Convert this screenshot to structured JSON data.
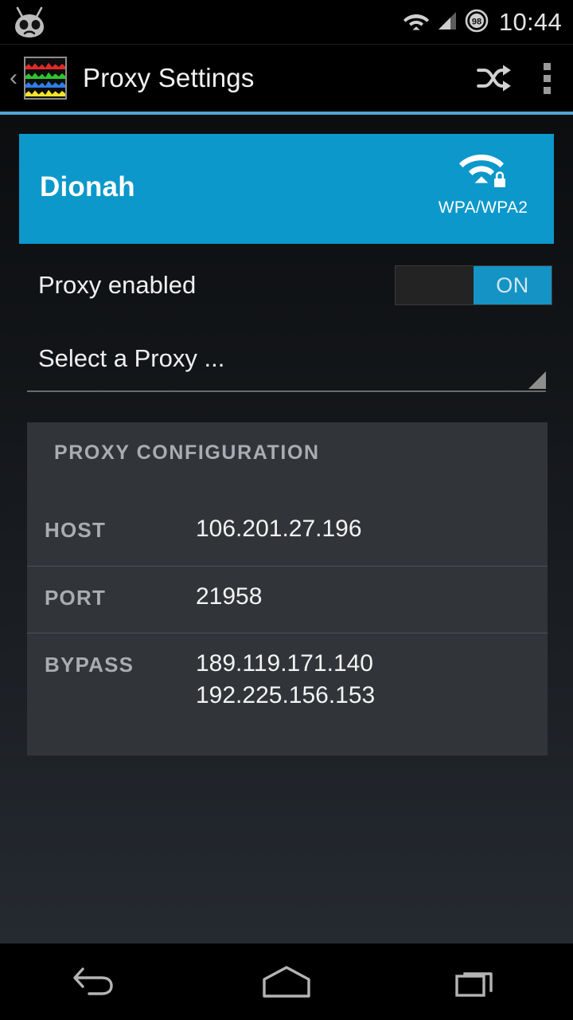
{
  "status_bar": {
    "logo_icon": "cyanogenmod-mascot-icon",
    "wifi_icon": "wifi-icon",
    "signal_icon": "cellular-signal-icon",
    "battery_icon": "battery-circle-icon",
    "battery_level": "98",
    "clock": "10:44"
  },
  "action_bar": {
    "back_icon": "back-chevron-icon",
    "app_icon": "app-waveform-icon",
    "title": "Proxy Settings",
    "shuffle_icon": "shuffle-icon",
    "overflow_icon": "overflow-menu-icon"
  },
  "wifi_card": {
    "ssid": "Dionah",
    "wifi_icon": "wifi-lock-icon",
    "security": "WPA/WPA2",
    "background_color": "#0c98ca"
  },
  "proxy_toggle": {
    "label": "Proxy enabled",
    "state_label": "ON",
    "on_color": "#1593c4"
  },
  "proxy_spinner": {
    "value": "Select a Proxy ...",
    "caret_icon": "dropdown-caret-icon"
  },
  "proxy_config": {
    "title": "PROXY CONFIGURATION",
    "rows": [
      {
        "label": "HOST",
        "values": [
          "106.201.27.196"
        ]
      },
      {
        "label": "PORT",
        "values": [
          "21958"
        ]
      },
      {
        "label": "BYPASS",
        "values": [
          "189.119.171.140",
          "192.225.156.153"
        ]
      }
    ]
  },
  "nav_bar": {
    "back_icon": "nav-back-icon",
    "home_icon": "nav-home-icon",
    "recents_icon": "nav-recents-icon"
  }
}
